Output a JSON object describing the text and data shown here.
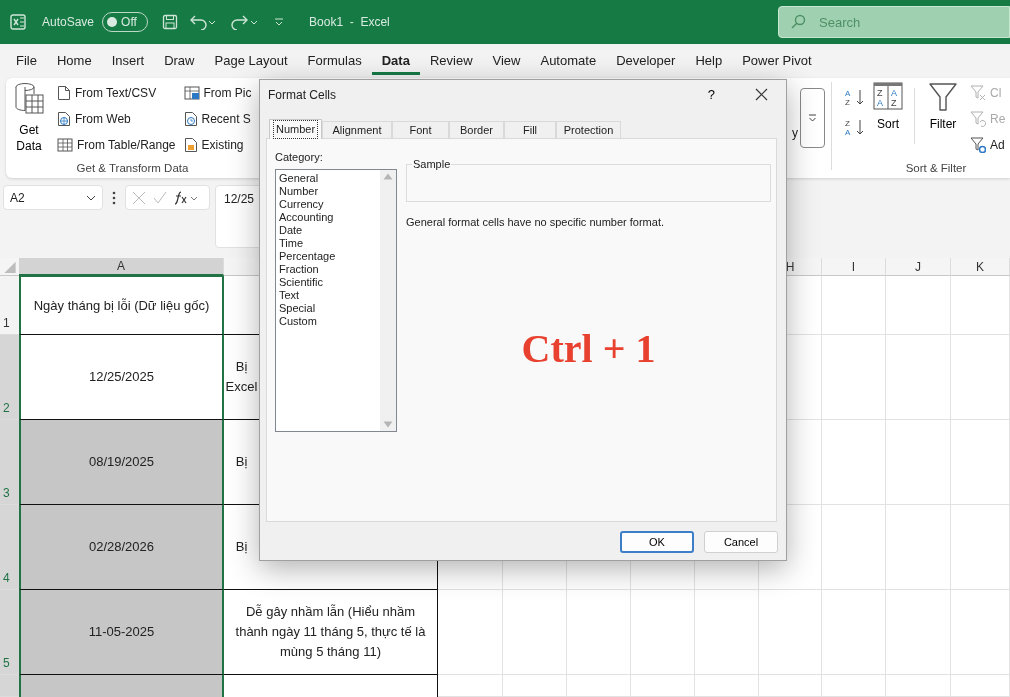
{
  "title_bar": {
    "autosave_label": "AutoSave",
    "autosave_toggle": {
      "label": "Off",
      "on": false
    },
    "document_title": "Book1  -  Excel",
    "search": {
      "placeholder": "Search"
    }
  },
  "ribbon_tabs": [
    {
      "label": "File",
      "selected": false
    },
    {
      "label": "Home",
      "selected": false
    },
    {
      "label": "Insert",
      "selected": false
    },
    {
      "label": "Draw",
      "selected": false
    },
    {
      "label": "Page Layout",
      "selected": false
    },
    {
      "label": "Formulas",
      "selected": false
    },
    {
      "label": "Data",
      "selected": true
    },
    {
      "label": "Review",
      "selected": false
    },
    {
      "label": "View",
      "selected": false
    },
    {
      "label": "Automate",
      "selected": false
    },
    {
      "label": "Developer",
      "selected": false
    },
    {
      "label": "Help",
      "selected": false
    },
    {
      "label": "Power Pivot",
      "selected": false
    }
  ],
  "ribbon": {
    "get_data": {
      "label_lines": [
        "Get",
        "Data"
      ]
    },
    "import_buttons": [
      {
        "label": "From Text/CSV"
      },
      {
        "label": "From Web"
      },
      {
        "label": "From Table/Range"
      }
    ],
    "source_buttons": [
      {
        "label": "From Pic"
      },
      {
        "label": "Recent S"
      },
      {
        "label": "Existing"
      }
    ],
    "get_transform_label": "Get & Transform Data",
    "queries_partial": "y",
    "sort_ascending_glyphs": [
      "A",
      "Z"
    ],
    "sort_descending_glyphs": [
      "Z",
      "A"
    ],
    "sort": {
      "label": "Sort",
      "glyphs": [
        "Z",
        "A",
        "A",
        "Z"
      ]
    },
    "filter": {
      "label": "Filter"
    },
    "filter_buttons": [
      {
        "label": "Cl",
        "disabled": true
      },
      {
        "label": "Re",
        "disabled": true
      },
      {
        "label": "Ad",
        "disabled": false
      }
    ],
    "sort_filter_label": "Sort & Filter"
  },
  "formula_bar": {
    "name_box": "A2",
    "formula": "12/25"
  },
  "sheet": {
    "columns": [
      {
        "label": "A",
        "selected": true
      },
      {
        "label": "H",
        "selected": false
      },
      {
        "label": "I",
        "selected": false
      },
      {
        "label": "J",
        "selected": false
      },
      {
        "label": "K",
        "selected": false
      }
    ],
    "rows": [
      {
        "header": "1",
        "selected": false,
        "cells": [
          {
            "kind": "full",
            "shaded": false,
            "text": "Ngày tháng bị lỗi (Dữ liệu gốc)"
          },
          {
            "kind": "full",
            "shaded": false
          }
        ]
      },
      {
        "header": "2",
        "selected": true,
        "cells": [
          {
            "kind": "full",
            "shaded": false,
            "text": "12/25/2025"
          },
          {
            "kind": "cut",
            "shaded": false,
            "lines": [
              "Bị",
              "Excel"
            ]
          }
        ]
      },
      {
        "header": "3",
        "selected": true,
        "cells": [
          {
            "kind": "full",
            "shaded": true,
            "text": "08/19/2025"
          },
          {
            "kind": "cut",
            "shaded": false,
            "lines": [
              "Bị"
            ]
          }
        ]
      },
      {
        "header": "4",
        "selected": true,
        "cells": [
          {
            "kind": "full",
            "shaded": true,
            "text": "02/28/2026"
          },
          {
            "kind": "cut",
            "shaded": false,
            "lines": [
              "Bị"
            ]
          }
        ]
      },
      {
        "header": "5",
        "selected": true,
        "cells": [
          {
            "kind": "full",
            "shaded": true,
            "text": "11-05-2025"
          },
          {
            "kind": "full",
            "shaded": false,
            "text": "Dễ gây nhầm lẫn (Hiểu nhầm thành ngày 11 tháng 5, thực tế là mùng 5 tháng 11)"
          }
        ]
      },
      {
        "selected": true,
        "cells": [
          {
            "kind": "full",
            "shaded": true
          },
          {
            "kind": "full",
            "shaded": false
          }
        ]
      }
    ]
  },
  "dialog": {
    "title": "Format Cells",
    "help": "?",
    "tabs": [
      {
        "label": "Number",
        "selected": true
      },
      {
        "label": "Alignment",
        "selected": false
      },
      {
        "label": "Font",
        "selected": false
      },
      {
        "label": "Border",
        "selected": false
      },
      {
        "label": "Fill",
        "selected": false
      },
      {
        "label": "Protection",
        "selected": false
      }
    ],
    "category_label": "Category:",
    "categories": [
      {
        "label": "General",
        "selected": false
      },
      {
        "label": "Number",
        "selected": false
      },
      {
        "label": "Currency",
        "selected": false
      },
      {
        "label": "Accounting",
        "selected": false
      },
      {
        "label": "Date",
        "selected": false
      },
      {
        "label": "Time",
        "selected": false
      },
      {
        "label": "Percentage",
        "selected": false
      },
      {
        "label": "Fraction",
        "selected": false
      },
      {
        "label": "Scientific",
        "selected": false
      },
      {
        "label": "Text",
        "selected": false
      },
      {
        "label": "Special",
        "selected": false
      },
      {
        "label": "Custom",
        "selected": false
      }
    ],
    "sample_label": "Sample",
    "description": "General format cells have no specific number format.",
    "annotation": "Ctrl + 1",
    "buttons": [
      {
        "label": "OK",
        "kind": "default"
      },
      {
        "label": "Cancel",
        "kind": "normal"
      }
    ]
  }
}
